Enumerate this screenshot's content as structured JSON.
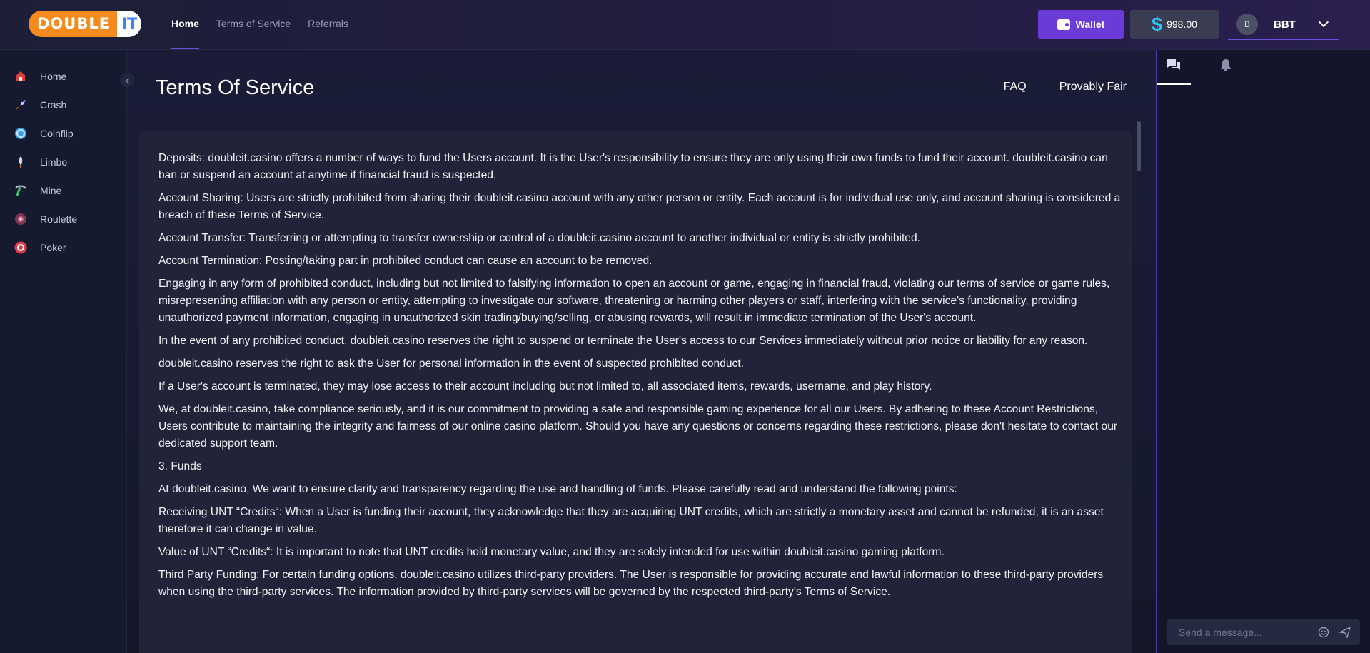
{
  "logo": {
    "part1": "DOUBLE",
    "part2": "IT"
  },
  "nav": {
    "items": [
      {
        "label": "Home",
        "active": true
      },
      {
        "label": "Terms of Service",
        "active": false
      },
      {
        "label": "Referrals",
        "active": false
      }
    ]
  },
  "header": {
    "wallet_label": "Wallet",
    "currency_symbol": "$",
    "balance": "998.00",
    "avatar_letter": "B",
    "username": "BBT"
  },
  "sidebar": {
    "items": [
      {
        "label": "Home",
        "icon": "home-icon",
        "color": "#e23d3d"
      },
      {
        "label": "Crash",
        "icon": "rocket-icon",
        "color": "#8b7bf2"
      },
      {
        "label": "Coinflip",
        "icon": "coin-icon",
        "color": "#3b9cf0"
      },
      {
        "label": "Limbo",
        "icon": "limbo-icon",
        "color": "#f07a3b"
      },
      {
        "label": "Mine",
        "icon": "mine-icon",
        "color": "#3ec46d"
      },
      {
        "label": "Roulette",
        "icon": "roulette-icon",
        "color": "#b04a6a"
      },
      {
        "label": "Poker",
        "icon": "poker-chip-icon",
        "color": "#e23d4d"
      }
    ]
  },
  "page": {
    "title": "Terms Of Service",
    "links": [
      "FAQ",
      "Provably Fair"
    ],
    "paragraphs": [
      "Deposits: doubleit.casino offers a number of ways to fund the Users account. It is the User's responsibility to ensure they are only using their own funds to fund their account. doubleit.casino can ban or suspend an account at anytime if financial fraud is suspected.",
      "Account Sharing: Users are strictly prohibited from sharing their doubleit.casino account with any other person or entity. Each account is for individual use only, and account sharing is considered a breach of these Terms of Service.",
      "Account Transfer: Transferring or attempting to transfer ownership or control of a doubleit.casino account to another individual or entity is strictly prohibited.",
      "Account Termination: Posting/taking part in prohibited conduct can cause an account to be removed.",
      "Engaging in any form of prohibited conduct, including but not limited to falsifying information to open an account or game, engaging in financial fraud, violating our terms of service or game rules, misrepresenting affiliation with any person or entity, attempting to investigate our software, threatening or harming other players or staff, interfering with the service's functionality, providing unauthorized payment information, engaging in unauthorized skin trading/buying/selling, or abusing rewards, will result in immediate termination of the User's account.",
      "In the event of any prohibited conduct, doubleit.casino reserves the right to suspend or terminate the User's access to our Services immediately without prior notice or liability for any reason.",
      "doubleit.casino reserves the right to ask the User for personal information in the event of suspected prohibited conduct.",
      "If a User's account is terminated, they may lose access to their account including but not limited to, all associated items, rewards, username, and play history.",
      "We, at doubleit.casino, take compliance seriously, and it is our commitment to providing a safe and responsible gaming experience for all our Users. By adhering to these Account Restrictions, Users contribute to maintaining the integrity and fairness of our online casino platform. Should you have any questions or concerns regarding these restrictions, please don't hesitate to contact our dedicated support team.",
      "3. Funds",
      "At doubleit.casino, We want to ensure clarity and transparency regarding the use and handling of funds. Please carefully read and understand the following points:",
      "Receiving UNT “Credits“: When a User is funding their account, they acknowledge that they are acquiring UNT credits, which are strictly a monetary asset and cannot be refunded, it is an asset therefore it can change in value.",
      "Value of UNT “Credits“: It is important to note that UNT credits hold monetary value, and they are solely intended for use within doubleit.casino gaming platform.",
      "Third Party Funding: For certain funding options, doubleit.casino utilizes third-party providers. The User is responsible for providing accurate and lawful information to these third-party providers when using the third-party services. The information provided by third-party services will be governed by the respected third-party's Terms of Service."
    ]
  },
  "chat": {
    "placeholder": "Send a message...",
    "tabs": [
      "chat-icon",
      "bell-icon"
    ]
  }
}
